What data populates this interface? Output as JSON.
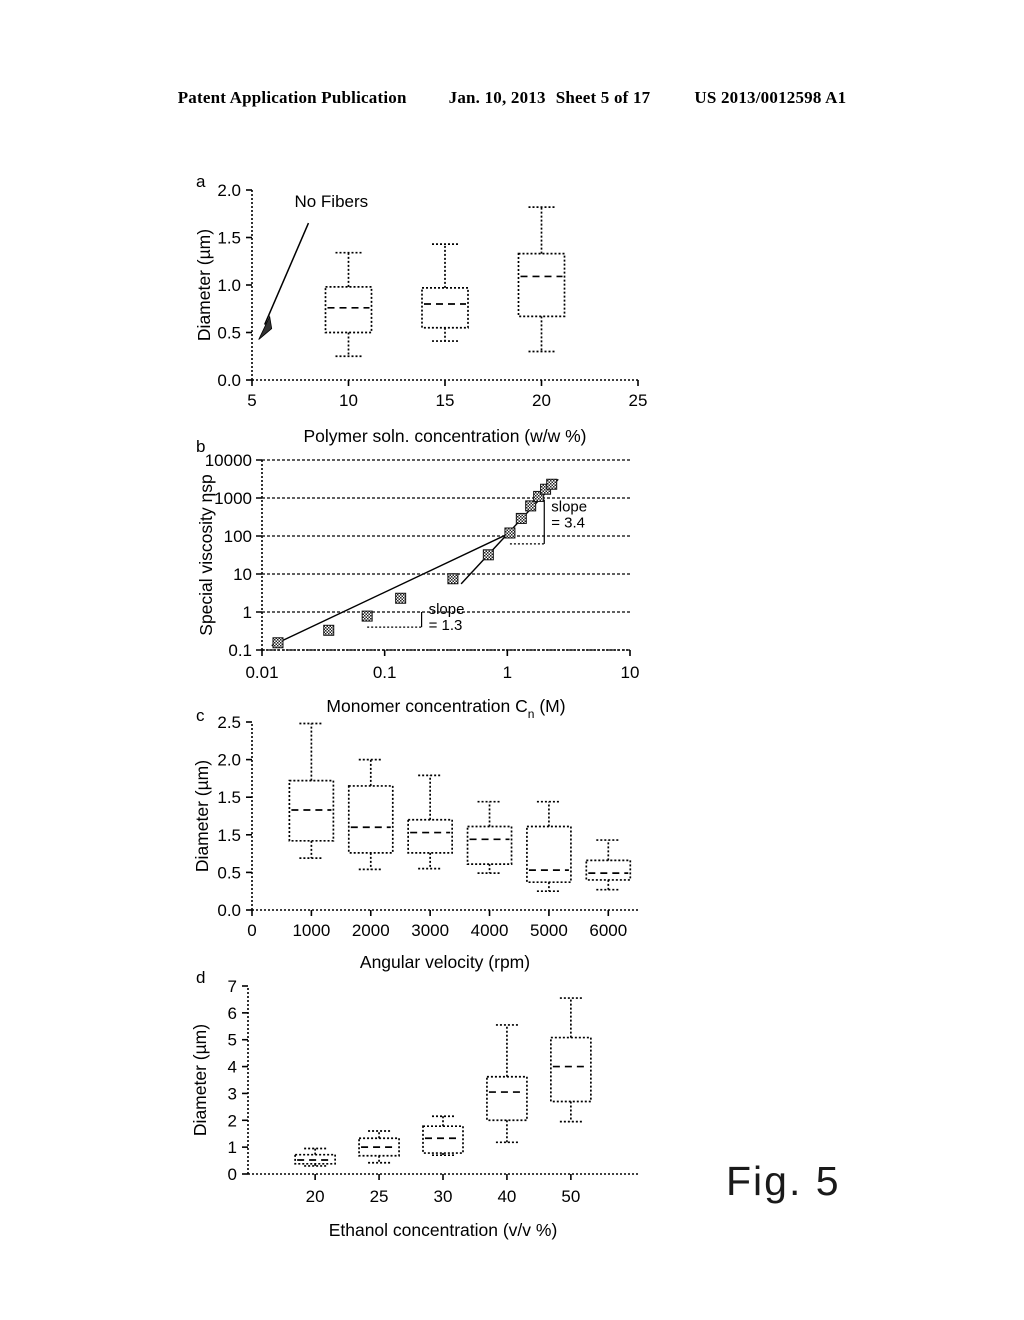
{
  "header": {
    "publication": "Patent Application Publication",
    "date": "Jan. 10, 2013",
    "sheet": "Sheet 5 of 17",
    "number": "US 2013/0012598 A1"
  },
  "figure": {
    "caption": "Fig. 5"
  },
  "panels": {
    "a": {
      "letter": "a"
    },
    "b": {
      "letter": "b"
    },
    "c": {
      "letter": "c"
    },
    "d": {
      "letter": "d"
    }
  },
  "chart_data": [
    {
      "id": "panel-a",
      "type": "box",
      "title": "",
      "xlabel": "Polymer soln. concentration (w/w %)",
      "ylabel": "Diameter  (µm)",
      "xlim": [
        5,
        25
      ],
      "ylim": [
        0.0,
        2.0
      ],
      "xticks": [
        5,
        10,
        15,
        20,
        25
      ],
      "xticklabels": [
        "5",
        "10",
        "15",
        "20",
        "25"
      ],
      "yticks": [
        0.0,
        0.5,
        1.0,
        1.5,
        2.0
      ],
      "yticklabels": [
        "0.0",
        "0.5",
        "1.0",
        "1.5",
        "2.0"
      ],
      "grid": false,
      "annotations": [
        {
          "text": "No Fibers",
          "x": 7.2,
          "y": 1.82,
          "arrow_to": {
            "x": 5.45,
            "y": 0.52
          }
        }
      ],
      "boxes": [
        {
          "category": "10",
          "x": 10,
          "whisker_low": 0.25,
          "q1": 0.5,
          "median": 0.76,
          "q3": 0.98,
          "whisker_high": 1.34
        },
        {
          "category": "15",
          "x": 15,
          "whisker_low": 0.41,
          "q1": 0.55,
          "median": 0.8,
          "q3": 0.97,
          "whisker_high": 1.43
        },
        {
          "category": "20",
          "x": 20,
          "whisker_low": 0.3,
          "q1": 0.67,
          "median": 1.09,
          "q3": 1.33,
          "whisker_high": 1.82
        }
      ]
    },
    {
      "id": "panel-b",
      "type": "scatter",
      "title": "",
      "xlabel": "Monomer concentration C",
      "xlabel_sub": "n",
      "xlabel_tail": " (M)",
      "ylabel": "Special viscosity ηsp",
      "xscale": "log",
      "yscale": "log",
      "xlim": [
        0.01,
        10
      ],
      "ylim": [
        0.1,
        10000
      ],
      "xticks": [
        0.01,
        0.1,
        1,
        10
      ],
      "xticklabels": [
        "0.01",
        "0.1",
        "1",
        "10"
      ],
      "yticks": [
        0.1,
        1,
        10,
        100,
        1000,
        10000
      ],
      "yticklabels": [
        "0.1",
        "1",
        "10",
        "100",
        "1000",
        "10000"
      ],
      "grid": true,
      "marker": "hatched-square",
      "points": [
        {
          "x": 0.0135,
          "y": 0.155
        },
        {
          "x": 0.035,
          "y": 0.33
        },
        {
          "x": 0.072,
          "y": 0.78
        },
        {
          "x": 0.135,
          "y": 2.3
        },
        {
          "x": 0.36,
          "y": 7.5
        },
        {
          "x": 0.7,
          "y": 32
        },
        {
          "x": 1.05,
          "y": 120
        },
        {
          "x": 1.3,
          "y": 290
        },
        {
          "x": 1.55,
          "y": 620
        },
        {
          "x": 1.8,
          "y": 1100
        },
        {
          "x": 2.05,
          "y": 1700
        },
        {
          "x": 2.3,
          "y": 2300
        }
      ],
      "fit_lines": [
        {
          "name": "low-slope",
          "slope": 1.3,
          "x0": 0.012,
          "y0": 0.13,
          "x1": 1.05,
          "y1": 120
        },
        {
          "name": "high-slope",
          "slope": 3.4,
          "x0": 0.42,
          "y0": 5.5,
          "x1": 2.6,
          "y1": 3100
        }
      ],
      "annotations": [
        {
          "text_line1": "slope",
          "text_line2": "= 1.3",
          "x": 0.2,
          "y": 1.0
        },
        {
          "text_line1": "slope",
          "text_line2": "= 3.4",
          "x": 2.0,
          "y": 330
        }
      ]
    },
    {
      "id": "panel-c",
      "type": "box",
      "title": "",
      "xlabel": "Angular velocity (rpm)",
      "ylabel": "Diameter  (µm)",
      "xlim": [
        0,
        6500
      ],
      "ylim": [
        0.0,
        2.5
      ],
      "xticks": [
        0,
        1000,
        2000,
        3000,
        4000,
        5000,
        6000
      ],
      "xticklabels": [
        "0",
        "1000",
        "2000",
        "3000",
        "4000",
        "5000",
        "6000"
      ],
      "yticks": [
        0.0,
        0.5,
        1.0,
        1.5,
        2.0,
        2.5
      ],
      "yticklabels": [
        "0.0",
        "0.5",
        "1.5",
        "1.5",
        "2.0",
        "2.5"
      ],
      "grid": false,
      "boxes": [
        {
          "category": "1000",
          "x": 1000,
          "whisker_low": 0.69,
          "q1": 0.92,
          "median": 1.33,
          "q3": 1.72,
          "whisker_high": 2.48
        },
        {
          "category": "2000",
          "x": 2000,
          "whisker_low": 0.54,
          "q1": 0.76,
          "median": 1.1,
          "q3": 1.65,
          "whisker_high": 2.0
        },
        {
          "category": "3000",
          "x": 3000,
          "whisker_low": 0.55,
          "q1": 0.76,
          "median": 1.03,
          "q3": 1.2,
          "whisker_high": 1.79
        },
        {
          "category": "4000",
          "x": 4000,
          "whisker_low": 0.49,
          "q1": 0.61,
          "median": 0.94,
          "q3": 1.11,
          "whisker_high": 1.44
        },
        {
          "category": "5000",
          "x": 5000,
          "whisker_low": 0.25,
          "q1": 0.37,
          "median": 0.53,
          "q3": 1.11,
          "whisker_high": 1.44
        },
        {
          "category": "6000",
          "x": 6000,
          "whisker_low": 0.27,
          "q1": 0.4,
          "median": 0.49,
          "q3": 0.66,
          "whisker_high": 0.93
        }
      ]
    },
    {
      "id": "panel-d",
      "type": "box",
      "title": "",
      "xlabel": "Ethanol concentration (v/v %)",
      "ylabel": "Diameter (µm)",
      "ylim": [
        0,
        7
      ],
      "categories": [
        "20",
        "25",
        "30",
        "40",
        "50"
      ],
      "yticks": [
        0,
        1,
        2,
        3,
        4,
        5,
        6,
        7
      ],
      "yticklabels": [
        "0",
        "1",
        "2",
        "3",
        "4",
        "5",
        "6",
        "7"
      ],
      "grid": false,
      "boxes": [
        {
          "category": "20",
          "whisker_low": 0.3,
          "q1": 0.38,
          "median": 0.52,
          "q3": 0.72,
          "whisker_high": 0.95
        },
        {
          "category": "25",
          "whisker_low": 0.42,
          "q1": 0.68,
          "median": 1.0,
          "q3": 1.33,
          "whisker_high": 1.6
        },
        {
          "category": "30",
          "whisker_low": 0.7,
          "q1": 0.78,
          "median": 1.33,
          "q3": 1.78,
          "whisker_high": 2.15
        },
        {
          "category": "40",
          "whisker_low": 1.18,
          "q1": 2.0,
          "median": 3.05,
          "q3": 3.62,
          "whisker_high": 5.55
        },
        {
          "category": "50",
          "whisker_low": 1.95,
          "q1": 2.7,
          "median": 4.0,
          "q3": 5.08,
          "whisker_high": 6.55
        }
      ]
    }
  ]
}
